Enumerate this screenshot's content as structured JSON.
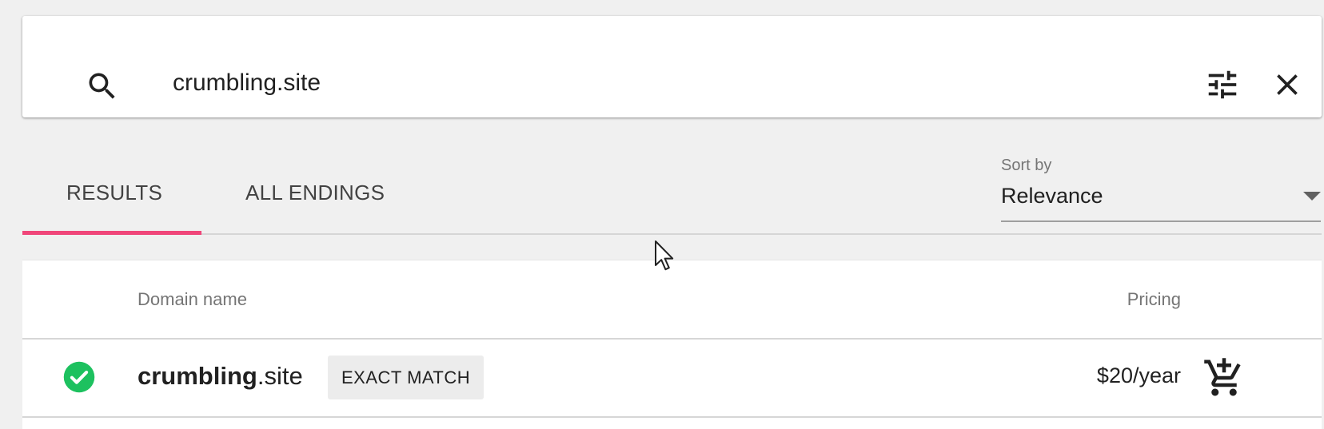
{
  "search": {
    "value": "crumbling.site",
    "placeholder": "",
    "icon": "search-icon",
    "filter_icon": "tune-icon",
    "clear_icon": "close-icon"
  },
  "tabs": [
    {
      "label": "RESULTS",
      "active": true
    },
    {
      "label": "ALL ENDINGS",
      "active": false
    }
  ],
  "sort": {
    "label": "Sort by",
    "value": "Relevance"
  },
  "table": {
    "columns": {
      "domain": "Domain name",
      "pricing": "Pricing"
    },
    "rows": [
      {
        "status_icon": "check-circle-icon",
        "sld": "crumbling",
        "tld": ".site",
        "badge": "EXACT MATCH",
        "price": "$20/year",
        "action_icon": "add-to-cart-icon"
      }
    ]
  },
  "colors": {
    "background": "#f0f0f0",
    "accent": "#f0467a",
    "available": "#1dc15f"
  }
}
